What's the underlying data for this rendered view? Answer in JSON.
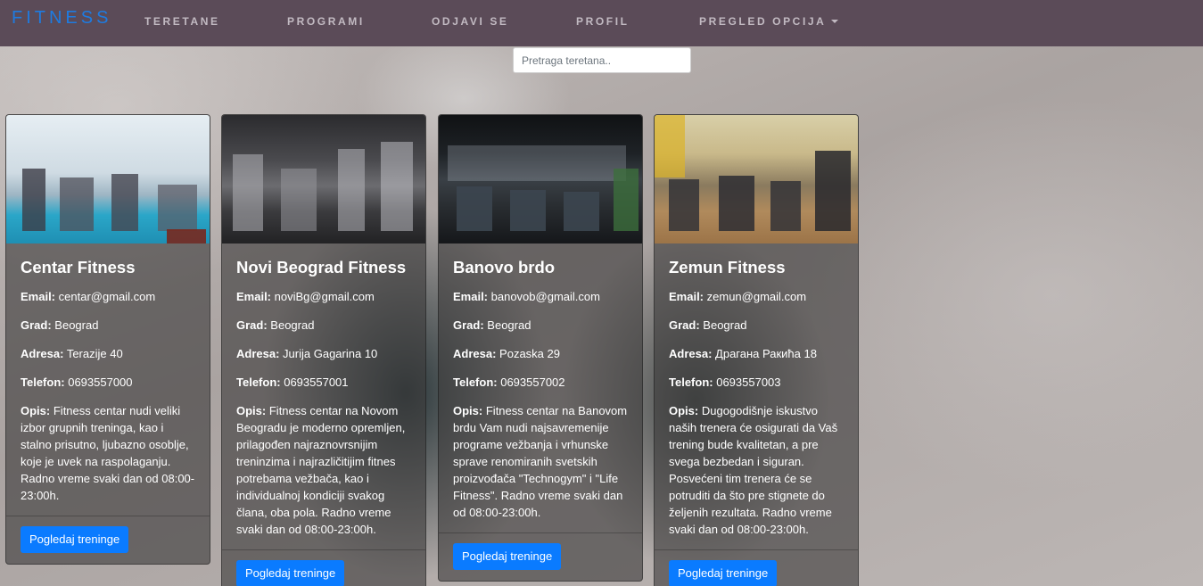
{
  "nav": {
    "brand": "FITNESS",
    "links": [
      "TERETANE",
      "PROGRAMI",
      "ODJAVI SE",
      "PROFIL",
      "PREGLED OPCIJA"
    ]
  },
  "search": {
    "placeholder": "Pretraga teretana.."
  },
  "labels": {
    "email": "Email:",
    "city": "Grad:",
    "address": "Adresa:",
    "phone": "Telefon:",
    "description": "Opis:"
  },
  "gyms": [
    {
      "name": "Centar Fitness",
      "email": "centar@gmail.com",
      "city": "Beograd",
      "address": "Terazije 40",
      "phone": "0693557000",
      "description": "Fitness centar nudi veliki izbor grupnih treninga, kao i stalno prisutno, ljubazno osoblje, koje je uvek na raspolaganju. Radno vreme svaki dan od 08:00-23:00h.",
      "button": "Pogledaj treninge"
    },
    {
      "name": "Novi Beograd Fitness",
      "email": "noviBg@gmail.com",
      "city": "Beograd",
      "address": "Jurija Gagarina 10",
      "phone": "0693557001",
      "description": "Fitness centar na Novom Beogradu je moderno opremljen, prilagođen najraznovrsnijim treninzima i najrazličitijim fitnes potrebama vežbača, kao i individualnoj kondiciji svakog člana, oba pola. Radno vreme svaki dan od 08:00-23:00h.",
      "button": "Pogledaj treninge"
    },
    {
      "name": "Banovo brdo",
      "email": "banovob@gmail.com",
      "city": "Beograd",
      "address": "Pozaska 29",
      "phone": "0693557002",
      "description": "Fitness centar na Banovom brdu Vam nudi najsavremenije programe vežbanja i vrhunske sprave renomiranih svetskih proizvođača \"Technogym\" i \"Life Fitness\". Radno vreme svaki dan od 08:00-23:00h.",
      "button": "Pogledaj treninge"
    },
    {
      "name": "Zemun Fitness",
      "email": "zemun@gmail.com",
      "city": "Beograd",
      "address": "Драгана Ракића 18",
      "phone": "0693557003",
      "description": "Dugogodišnje iskustvo naših trenera će osigurati da Vaš trening bude kvalitetan, a pre svega bezbedan i siguran. Posvećeni tim trenera će se potruditi da što pre stignete do željenih rezultata. Radno vreme svaki dan od 08:00-23:00h.",
      "button": "Pogledaj treninge"
    }
  ]
}
